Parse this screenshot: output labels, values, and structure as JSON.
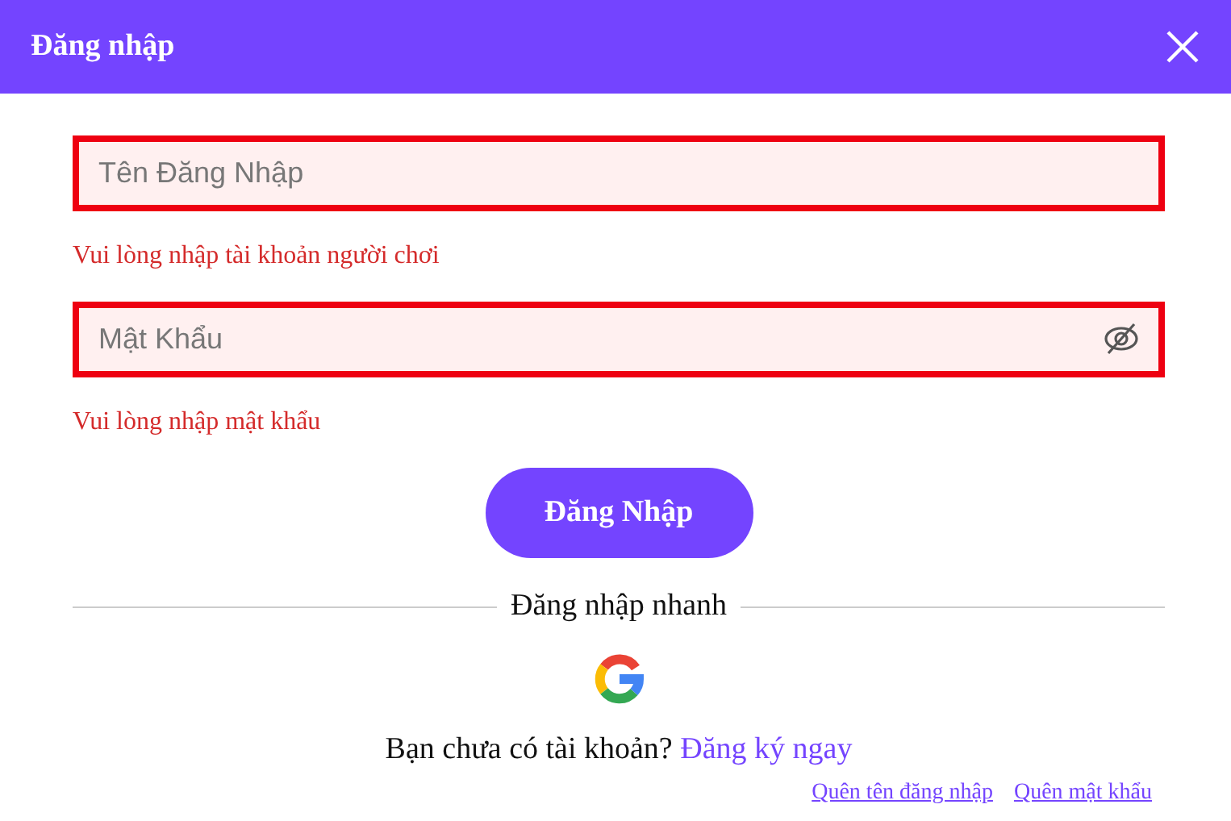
{
  "dialog": {
    "title": "Đăng nhập"
  },
  "fields": [
    {
      "kind": "text",
      "placeholder": "Tên Đăng Nhập",
      "invalid": true,
      "error": "Vui lòng nhập tài khoản người chơi"
    },
    {
      "kind": "password",
      "placeholder": "Mật Khẩu",
      "invalid": true,
      "error": "Vui lòng nhập mật khẩu"
    }
  ],
  "submit": "Đăng Nhập",
  "quick_login": {
    "label": "Đăng nhập nhanh"
  },
  "signup": {
    "prompt": "Bạn chưa có tài khoản?",
    "link": "Đăng ký ngay"
  },
  "forgot_links": [
    "Quên tên đăng nhập",
    "Quên mật khẩu"
  ]
}
